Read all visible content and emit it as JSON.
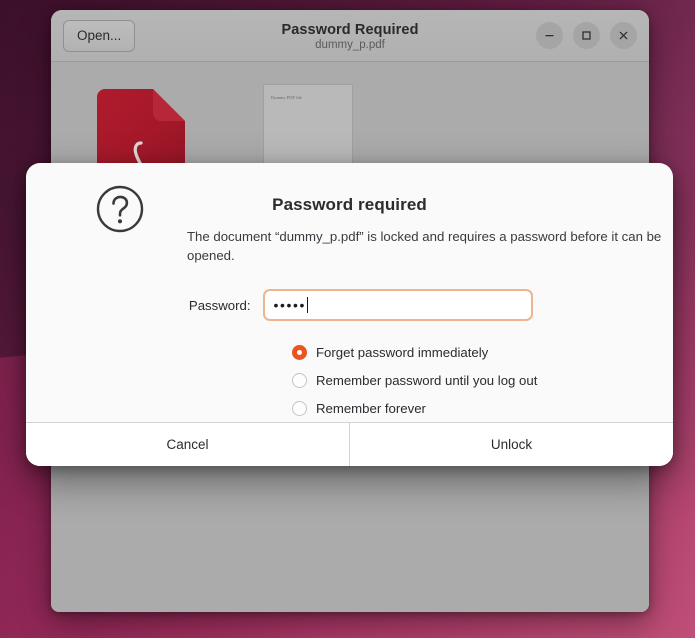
{
  "window": {
    "title": "Password Required",
    "subtitle": "dummy_p.pdf",
    "open_button_label": "Open...",
    "controls": {
      "minimize": "minimize-icon",
      "maximize": "maximize-icon",
      "close": "close-icon"
    }
  },
  "document_view": {
    "pdf_icon_name": "pdf-file-icon",
    "thumbnail_text": "Dummy PDF file"
  },
  "dialog": {
    "icon_name": "question-mark-icon",
    "heading": "Password required",
    "description": "The document “dummy_p.pdf” is locked and requires a password before it can be opened.",
    "password_label": "Password:",
    "password_value": "•••••",
    "password_placeholder": "",
    "options": [
      {
        "label": "Forget password immediately",
        "selected": true
      },
      {
        "label": "Remember password until you log out",
        "selected": false
      },
      {
        "label": "Remember forever",
        "selected": false
      }
    ],
    "cancel_label": "Cancel",
    "unlock_label": "Unlock"
  },
  "colors": {
    "accent": "#e95420",
    "focus_border": "#f0b48d",
    "dialog_bg": "#fafafa",
    "window_chrome": "#b3b3b3",
    "content_gray": "#ababab",
    "desktop_purple": "#5c1a3c"
  }
}
